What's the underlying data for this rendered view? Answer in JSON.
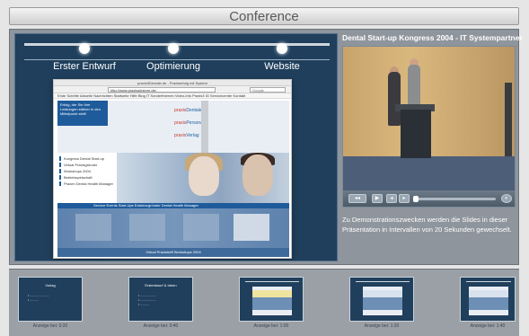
{
  "header": {
    "title": "Conference"
  },
  "steps": [
    {
      "label": "Erster Entwurf"
    },
    {
      "label": "Optimierung"
    },
    {
      "label": "Website"
    }
  ],
  "browser": {
    "title": "praxis3Dentale.de - Praxiserfolg mit System",
    "url": "http://www.praxissiestore.de/",
    "search_placeholder": "Google",
    "bookmarks": "Erste Schritte  Aktuelle Nachrichten  Startseite  Hilfe  Blog  IT  Sonderthemen  Video-Info  Praxis3 IG  Servicecenter  Kontakt"
  },
  "page": {
    "intro": "Erfolg, der Sie Ihre Leistungen stärker in den Mittelpunkt stellt",
    "brands": [
      {
        "prefix": "praxis",
        "name": "Dentale"
      },
      {
        "prefix": "praxis",
        "name": "Personal"
      },
      {
        "prefix": "praxis",
        "name": "Verlag"
      }
    ],
    "menu": [
      "Kongress Dental Start-up",
      "Virtual Praxisgründer",
      "Workshops 2004",
      "Betriebswirtschaft",
      "Praxen Dental Health Manager"
    ],
    "band": "Service  Events  Start-Ups  Existenzgründer  Dental Health Manager",
    "footer": "Virtual Praxistreff Workshops 2004"
  },
  "video": {
    "title": "Dental Start-up Kongress 2004 - IT Systempartner",
    "controls": {
      "rewind": "◂◂",
      "play": "▶",
      "back": "◂",
      "forward": "▸",
      "volume": "◐"
    },
    "progress": 0.02
  },
  "description": "Zu Demonstrationszwecken werden die Slides in dieser Präsentation in Intervallen von 20 Sekunden gewechselt.",
  "thumbs": [
    {
      "title": "Vorlag",
      "caption": "Anzeige bei: 0:20",
      "kind": "text"
    },
    {
      "title": "Erstentwurf & Ideen",
      "caption": "Anzeige bei: 0:40",
      "kind": "text"
    },
    {
      "title": "",
      "caption": "Anzeige bei: 1:00",
      "kind": "page"
    },
    {
      "title": "",
      "caption": "Anzeige bei: 1:20",
      "kind": "page"
    },
    {
      "title": "",
      "caption": "Anzeige bei: 1:40",
      "kind": "page"
    }
  ]
}
